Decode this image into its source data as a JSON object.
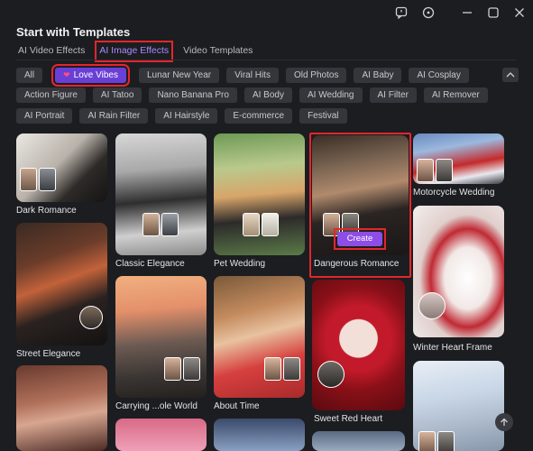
{
  "header": {
    "title": "Start with Templates"
  },
  "tabs": [
    {
      "label": "AI Video Effects"
    },
    {
      "label": "AI Image Effects",
      "active": true
    },
    {
      "label": "Video Templates"
    }
  ],
  "chips": {
    "row1": [
      "All",
      "Love Vibes",
      "Lunar New Year",
      "Viral Hits",
      "Old Photos",
      "AI Baby",
      "AI Cosplay"
    ],
    "row2": [
      "Action Figure",
      "AI Tatoo",
      "Nano Banana Pro",
      "AI Body",
      "AI Wedding",
      "AI Filter",
      "AI Remover"
    ],
    "row3": [
      "AI Portrait",
      "AI Rain Filter",
      "AI Hairstyle",
      "E-commerce",
      "Festival"
    ],
    "active": "Love Vibes"
  },
  "cards": {
    "dark_romance": "Dark Romance",
    "classic_elegance": "Classic Elegance",
    "pet_wedding": "Pet Wedding",
    "dangerous_romance": "Dangerous Romance",
    "motorcycle_wedding": "Motorcycle Wedding",
    "street_elegance": "Street Elegance",
    "carrying_whole_world": "Carrying ...ole World",
    "about_time": "About Time",
    "sweet_red_heart": "Sweet Red Heart",
    "winter_heart_frame": "Winter Heart Frame"
  },
  "create_button": "Create",
  "icons": {
    "feedback": "feedback-icon",
    "settings": "circle-dot-icon",
    "minimize": "minimize-icon",
    "maximize": "maximize-icon",
    "close": "close-icon",
    "collapse": "chevron-up-icon",
    "scroll_top": "arrow-up-icon"
  },
  "colors": {
    "accent": "#6a3fd6",
    "active_tab": "#a58cff",
    "highlight": "#e3262c",
    "create": "#8e4de6"
  }
}
